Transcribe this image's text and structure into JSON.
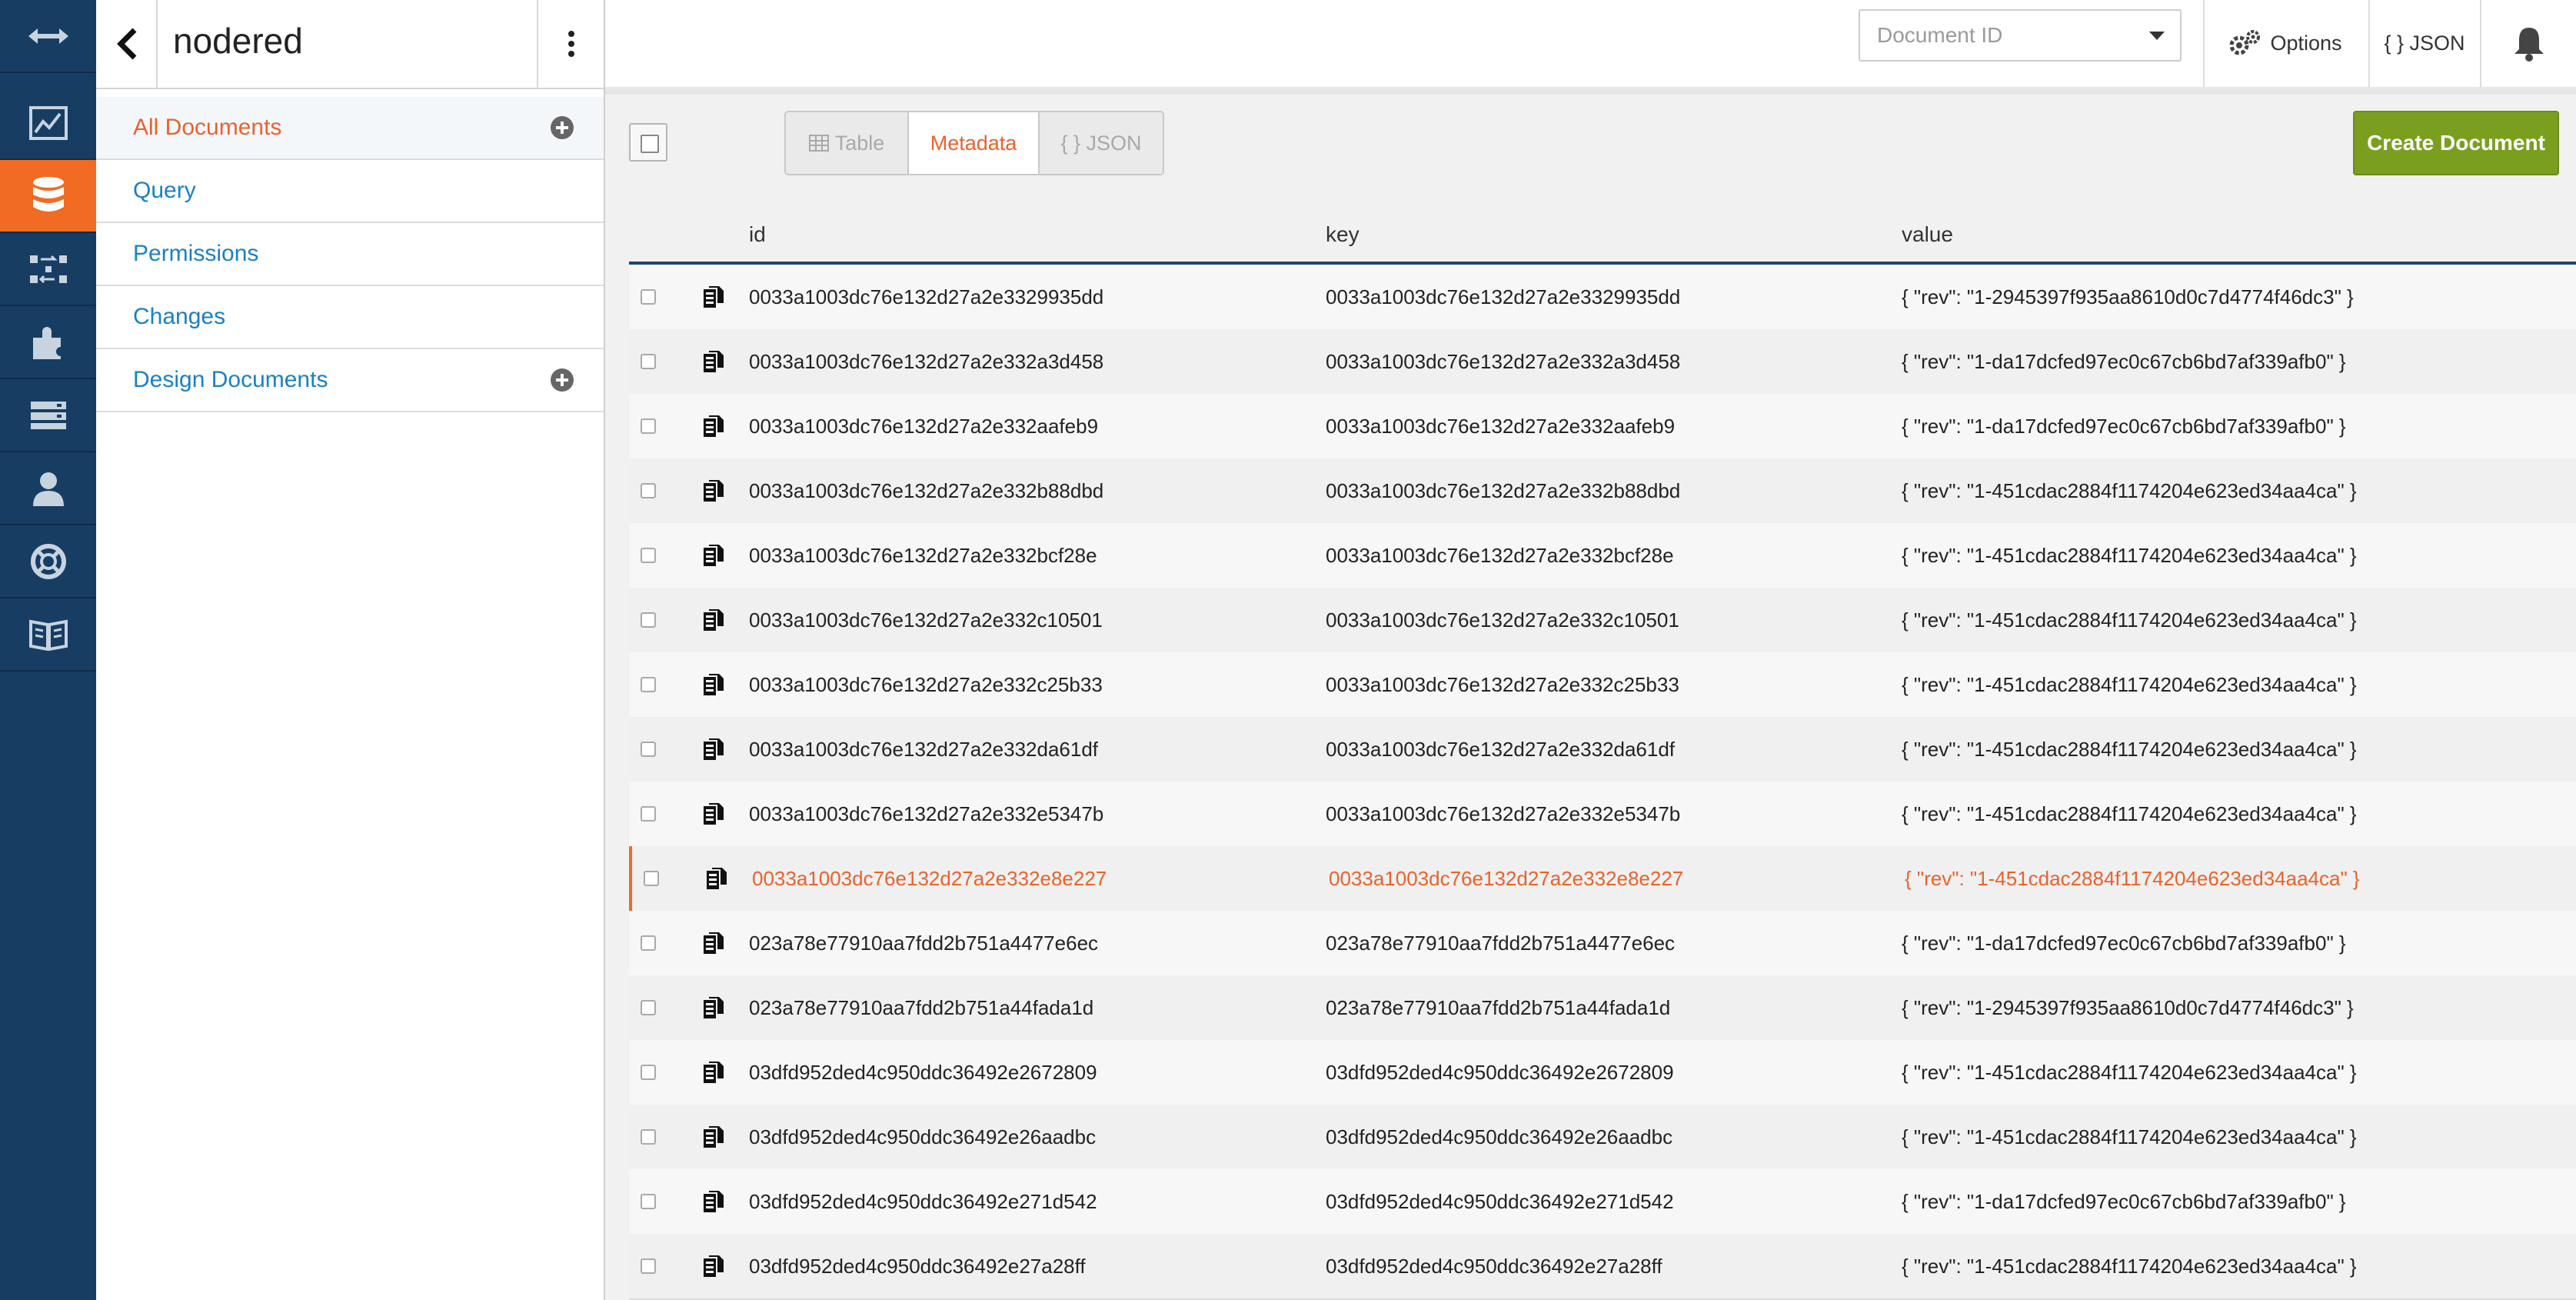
{
  "sidebar": {
    "title": "nodered",
    "items": [
      {
        "label": "All Documents",
        "active": true,
        "has_add": true
      },
      {
        "label": "Query",
        "active": false,
        "has_add": false
      },
      {
        "label": "Permissions",
        "active": false,
        "has_add": false
      },
      {
        "label": "Changes",
        "active": false,
        "has_add": false
      },
      {
        "label": "Design Documents",
        "active": false,
        "has_add": true
      }
    ]
  },
  "topbar": {
    "docid_placeholder": "Document ID",
    "options_label": "Options",
    "json_label": "{ } JSON"
  },
  "toolbar": {
    "views": [
      {
        "label": "Table",
        "active": false
      },
      {
        "label": "Metadata",
        "active": true
      },
      {
        "label": "{ } JSON",
        "active": false
      }
    ],
    "create_label": "Create Document"
  },
  "table": {
    "headers": [
      "id",
      "key",
      "value"
    ],
    "rows": [
      {
        "id": "0033a1003dc76e132d27a2e3329935dd",
        "key": "0033a1003dc76e132d27a2e3329935dd",
        "value": "{ \"rev\": \"1-2945397f935aa8610d0c7d4774f46dc3\" }"
      },
      {
        "id": "0033a1003dc76e132d27a2e332a3d458",
        "key": "0033a1003dc76e132d27a2e332a3d458",
        "value": "{ \"rev\": \"1-da17dcfed97ec0c67cb6bd7af339afb0\" }"
      },
      {
        "id": "0033a1003dc76e132d27a2e332aafeb9",
        "key": "0033a1003dc76e132d27a2e332aafeb9",
        "value": "{ \"rev\": \"1-da17dcfed97ec0c67cb6bd7af339afb0\" }"
      },
      {
        "id": "0033a1003dc76e132d27a2e332b88dbd",
        "key": "0033a1003dc76e132d27a2e332b88dbd",
        "value": "{ \"rev\": \"1-451cdac2884f1174204e623ed34aa4ca\" }"
      },
      {
        "id": "0033a1003dc76e132d27a2e332bcf28e",
        "key": "0033a1003dc76e132d27a2e332bcf28e",
        "value": "{ \"rev\": \"1-451cdac2884f1174204e623ed34aa4ca\" }"
      },
      {
        "id": "0033a1003dc76e132d27a2e332c10501",
        "key": "0033a1003dc76e132d27a2e332c10501",
        "value": "{ \"rev\": \"1-451cdac2884f1174204e623ed34aa4ca\" }"
      },
      {
        "id": "0033a1003dc76e132d27a2e332c25b33",
        "key": "0033a1003dc76e132d27a2e332c25b33",
        "value": "{ \"rev\": \"1-451cdac2884f1174204e623ed34aa4ca\" }"
      },
      {
        "id": "0033a1003dc76e132d27a2e332da61df",
        "key": "0033a1003dc76e132d27a2e332da61df",
        "value": "{ \"rev\": \"1-451cdac2884f1174204e623ed34aa4ca\" }"
      },
      {
        "id": "0033a1003dc76e132d27a2e332e5347b",
        "key": "0033a1003dc76e132d27a2e332e5347b",
        "value": "{ \"rev\": \"1-451cdac2884f1174204e623ed34aa4ca\" }"
      },
      {
        "id": "0033a1003dc76e132d27a2e332e8e227",
        "key": "0033a1003dc76e132d27a2e332e8e227",
        "value": "{ \"rev\": \"1-451cdac2884f1174204e623ed34aa4ca\" }",
        "highlighted": true
      },
      {
        "id": "023a78e77910aa7fdd2b751a4477e6ec",
        "key": "023a78e77910aa7fdd2b751a4477e6ec",
        "value": "{ \"rev\": \"1-da17dcfed97ec0c67cb6bd7af339afb0\" }"
      },
      {
        "id": "023a78e77910aa7fdd2b751a44fada1d",
        "key": "023a78e77910aa7fdd2b751a44fada1d",
        "value": "{ \"rev\": \"1-2945397f935aa8610d0c7d4774f46dc3\" }"
      },
      {
        "id": "03dfd952ded4c950ddc36492e2672809",
        "key": "03dfd952ded4c950ddc36492e2672809",
        "value": "{ \"rev\": \"1-451cdac2884f1174204e623ed34aa4ca\" }"
      },
      {
        "id": "03dfd952ded4c950ddc36492e26aadbc",
        "key": "03dfd952ded4c950ddc36492e26aadbc",
        "value": "{ \"rev\": \"1-451cdac2884f1174204e623ed34aa4ca\" }"
      },
      {
        "id": "03dfd952ded4c950ddc36492e271d542",
        "key": "03dfd952ded4c950ddc36492e271d542",
        "value": "{ \"rev\": \"1-da17dcfed97ec0c67cb6bd7af339afb0\" }"
      },
      {
        "id": "03dfd952ded4c950ddc36492e27a28ff",
        "key": "03dfd952ded4c950ddc36492e27a28ff",
        "value": "{ \"rev\": \"1-451cdac2884f1174204e623ed34aa4ca\" }"
      }
    ]
  },
  "nav_icons": [
    "collapse-arrows-icon",
    "activity-chart-icon",
    "database-icon",
    "replication-icon",
    "plugins-icon",
    "server-config-icon",
    "user-icon",
    "help-lifebuoy-icon",
    "documentation-book-icon"
  ],
  "colors": {
    "nav_bg": "#173d63",
    "nav_active": "#f26b22",
    "link": "#1a80c4",
    "accent": "#e9622c",
    "create_btn": "#7a9f1f"
  }
}
